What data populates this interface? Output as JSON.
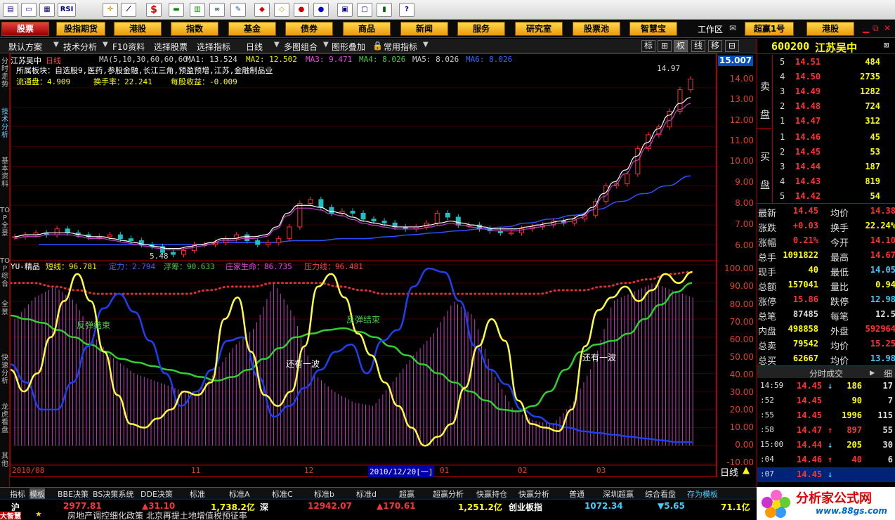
{
  "toolbar": {
    "icons": [
      "chart-icon",
      "monitor-icon",
      "grid-icon",
      "rsi-icon",
      "cross-icon",
      "ruler-icon",
      "dollar-icon",
      "flag-icon",
      "bars-icon",
      "binoculars-icon",
      "pen-icon",
      "bookmark-icon",
      "diamond-icon",
      "tag-icon",
      "tag2-icon",
      "save-icon",
      "window-icon",
      "books-icon",
      "help-icon"
    ],
    "rsi_label": "RSI",
    "dollar_label": "$"
  },
  "nav": {
    "items": [
      "股票",
      "股指期货",
      "港股",
      "指数",
      "基金",
      "债券",
      "商品",
      "新闻",
      "服务",
      "研究室",
      "股票池",
      "智慧宝"
    ],
    "workspace": "工作区",
    "account": "超赢1号",
    "hk": "港股"
  },
  "toolbar2": {
    "items": [
      "默认方案",
      "技术分析",
      "F10资料",
      "选择股票",
      "选择指标",
      "日线",
      "多图组合",
      "图形叠加",
      "常用指标"
    ],
    "right_buttons": [
      "标",
      "⊞",
      "权",
      "线",
      "移",
      "⊟"
    ]
  },
  "vtabs": [
    "分时走势",
    "技术分析",
    "基本资料",
    "TOP全景",
    "TOP综合",
    "全景",
    "快速分析",
    "龙虎看盘",
    "其他"
  ],
  "chart": {
    "header_name": "江苏吴中",
    "header_period": "日线",
    "ma_params": "MA(5,10,30,60,60,60)",
    "ma1": "MA1: 13.524",
    "ma2": "MA2: 12.502",
    "ma3": "MA3: 9.471",
    "ma4": "MA4: 8.026",
    "ma5": "MA5: 8.026",
    "ma6": "MA6: 8.026",
    "sector": "所属板块：自选股9,医药,参股金融,长江三角,预盈预增,江苏,金融制品业",
    "float": "流通盘：4.909",
    "turnover": "换手率：22.241",
    "eps": "每股收益：-0.009",
    "peak_label": "14.97",
    "low_label": "5.48",
    "current_price": "15.007",
    "y_axis": [
      "14.00",
      "13.00",
      "12.00",
      "11.00",
      "10.00",
      "9.00",
      "8.00",
      "7.00",
      "6.00"
    ],
    "ind_name": "YU-精品",
    "short": "短线：96.781",
    "stand": "定力：2.794",
    "float_chip": "浮筹：90.633",
    "life": "庄家生命：86.735",
    "pressure": "压力线：96.481",
    "ind_y": [
      "100.00",
      "90.00",
      "80.00",
      "70.00",
      "60.00",
      "50.00",
      "40.00",
      "30.00",
      "20.00",
      "10.00",
      "0.00",
      "-10.00"
    ],
    "annot": [
      "反弹结束",
      "反弹结束",
      "还有一波",
      "还有一波"
    ],
    "x_labels": [
      "2010/08",
      "11",
      "12",
      "01",
      "02",
      "03"
    ],
    "cursor_date": "2010/12/20[一]",
    "period": "日线"
  },
  "chart_data": [
    {
      "type": "candlestick",
      "title": "江苏吴中 日线",
      "ylim": [
        5.5,
        15.0
      ],
      "close": [
        6.4,
        6.5,
        6.6,
        6.5,
        6.8,
        6.6,
        6.5,
        6.4,
        6.4,
        6.5,
        6.3,
        6.2,
        6.0,
        5.9,
        5.6,
        5.5,
        5.7,
        6.0,
        6.0,
        6.1,
        6.3,
        6.5,
        6.2,
        6.0,
        6.1,
        6.3,
        6.9,
        8.1,
        8.3,
        7.9,
        7.6,
        7.7,
        7.6,
        7.3,
        7.2,
        7.1,
        6.9,
        6.8,
        6.9,
        7.1,
        7.6,
        7.4,
        7.0,
        7.0,
        6.8,
        6.7,
        6.6,
        6.6,
        6.8,
        6.9,
        7.0,
        7.2,
        7.1,
        7.3,
        7.5,
        8.2,
        9.0,
        9.1,
        9.6,
        10.9,
        11.6,
        12.0,
        12.8,
        13.9,
        14.45
      ],
      "ma_fast": [
        6.4,
        6.5,
        6.5,
        6.6,
        6.6,
        6.6,
        6.5,
        6.4,
        6.4,
        6.3,
        6.2,
        6.1,
        6.0,
        5.9,
        5.8,
        5.8,
        5.9,
        6.0,
        6.1,
        6.3,
        6.3,
        6.4,
        6.4,
        6.5,
        6.9,
        7.6,
        8.0,
        8.0,
        7.9,
        7.7,
        7.6,
        7.4,
        7.2,
        7.1,
        7.0,
        6.9,
        6.9,
        6.9,
        7.0,
        7.1,
        7.2,
        7.1,
        7.0,
        6.9,
        6.8,
        6.8,
        6.8,
        6.9,
        7.0,
        7.1,
        7.2,
        7.3,
        7.5,
        7.9,
        8.6,
        9.2,
        9.8,
        10.5,
        11.2,
        11.9,
        12.6,
        13.2,
        13.5
      ],
      "ma_long": [
        6.0,
        6.0,
        6.0,
        6.0,
        6.0,
        6.0,
        6.0,
        6.0,
        6.1,
        6.1,
        6.1,
        6.2,
        6.2,
        6.3,
        6.3,
        6.4,
        6.5,
        6.6,
        6.7,
        6.8,
        6.9,
        7.1,
        7.3,
        7.5,
        7.8,
        8.2,
        8.6,
        9.0,
        9.5
      ]
    },
    {
      "type": "line",
      "title": "YU-精品",
      "ylim": [
        -10,
        100
      ],
      "series": [
        {
          "name": "短线",
          "values": [
            42,
            30,
            40,
            60,
            80,
            95,
            80,
            52,
            28,
            12,
            10,
            15,
            20,
            30,
            28,
            35,
            70,
            82,
            52,
            28,
            22,
            30,
            55,
            88,
            95,
            82,
            62,
            50,
            35,
            22,
            10,
            0,
            5,
            12,
            32,
            55,
            70,
            58,
            25,
            12,
            10,
            8,
            20,
            55,
            75,
            82,
            88,
            80,
            86,
            95,
            90,
            96
          ]
        },
        {
          "name": "定力",
          "values": [
            45,
            35,
            20,
            20,
            35,
            55,
            76,
            84,
            74,
            58,
            40,
            22,
            30,
            42,
            58,
            60,
            38,
            16,
            22,
            32,
            42,
            52,
            56,
            40,
            58,
            64,
            88,
            98,
            96,
            80,
            55,
            42,
            34,
            20,
            16,
            12,
            10,
            8,
            7,
            6,
            5,
            4,
            3,
            2,
            2
          ]
        },
        {
          "name": "浮筹",
          "values": [
            72,
            70,
            68,
            64,
            60,
            56,
            52,
            48,
            46,
            44,
            42,
            40,
            38,
            36,
            38,
            42,
            48,
            54,
            60,
            62,
            64,
            65,
            63,
            60,
            55,
            50,
            45,
            40,
            35,
            30,
            25,
            20,
            19,
            22,
            30,
            42,
            52,
            56,
            58,
            62,
            70,
            78,
            85,
            90
          ]
        },
        {
          "name": "压力线",
          "values": [
            90,
            90,
            88,
            86,
            84,
            84,
            84,
            84,
            84,
            86,
            88,
            88,
            90,
            90,
            90,
            88,
            86,
            84,
            84,
            84,
            84,
            84,
            84,
            84,
            84,
            86,
            86,
            88,
            90,
            92,
            95,
            96
          ]
        },
        {
          "name": "庄家生命",
          "values": [
            70,
            82,
            88,
            80,
            60,
            48,
            40,
            36,
            32,
            28,
            40,
            55,
            65,
            90,
            72,
            40,
            30,
            24,
            22,
            36,
            50,
            62,
            80,
            72,
            40,
            20,
            14,
            12,
            24,
            45,
            80,
            85,
            90,
            86,
            82
          ]
        }
      ]
    }
  ],
  "quote": {
    "code": "600200",
    "name": "江苏吴中",
    "asks": [
      {
        "level": "5",
        "price": "14.51",
        "vol": "484"
      },
      {
        "level": "4",
        "price": "14.50",
        "vol": "2735"
      },
      {
        "level": "3",
        "price": "14.49",
        "vol": "1282"
      },
      {
        "level": "2",
        "price": "14.48",
        "vol": "724"
      },
      {
        "level": "1",
        "price": "14.47",
        "vol": "312"
      }
    ],
    "bids": [
      {
        "level": "1",
        "price": "14.46",
        "vol": "45"
      },
      {
        "level": "2",
        "price": "14.45",
        "vol": "53"
      },
      {
        "level": "3",
        "price": "14.44",
        "vol": "187"
      },
      {
        "level": "4",
        "price": "14.43",
        "vol": "819"
      },
      {
        "level": "5",
        "price": "14.42",
        "vol": "54"
      }
    ],
    "sell_label": "卖盘",
    "buy_label": "买盘",
    "stats": [
      [
        "最新",
        "14.45",
        "均价",
        "14.38"
      ],
      [
        "涨跌",
        "+0.03",
        "换手",
        "22.24%"
      ],
      [
        "涨幅",
        "0.21%",
        "今开",
        "14.10"
      ],
      [
        "总手",
        "1091822",
        "最高",
        "14.67"
      ],
      [
        "现手",
        "40",
        "最低",
        "14.05"
      ],
      [
        "总额",
        "157041",
        "量比",
        "0.94"
      ],
      [
        "涨停",
        "15.86",
        "跌停",
        "12.98"
      ],
      [
        "总笔",
        "87485",
        "每笔",
        "12.5"
      ],
      [
        "内盘",
        "498858",
        "外盘",
        "592964"
      ],
      [
        "总卖",
        "79542",
        "均价",
        "15.25"
      ],
      [
        "总买",
        "62667",
        "均价",
        "13.98"
      ]
    ],
    "ticks_title": "分时成交",
    "ticks_more": "细",
    "ticks": [
      [
        "14:59",
        "14.45",
        "↓",
        "186",
        "17"
      ],
      [
        ":52",
        "14.45",
        "",
        "90",
        "7"
      ],
      [
        ":55",
        "14.45",
        "",
        "1996",
        "115"
      ],
      [
        ":58",
        "14.47",
        "↑",
        "897",
        "55"
      ],
      [
        "15:00",
        "14.44",
        "↓",
        "205",
        "30"
      ],
      [
        ":04",
        "14.46",
        "↑",
        "40",
        "6"
      ],
      [
        ":07",
        "14.45",
        "↓",
        "",
        ""
      ]
    ]
  },
  "bottom_tabs": [
    "指标",
    "模板",
    "BBE决策",
    "BS决策系统",
    "DDE决策",
    "标准",
    "标准A",
    "标准C",
    "标准b",
    "标准d",
    "超赢",
    "超赢分析",
    "快赢持仓",
    "快赢分析",
    "普通",
    "深圳超赢",
    "综合看盘",
    "存为模板"
  ],
  "index_bar": {
    "sh": "沪",
    "sh_val": "2977.81",
    "sh_chg": "▲31.10",
    "sh_amt": "1,738.2亿",
    "sz": "深",
    "sz_val": "12942.07",
    "sz_chg": "▲170.61",
    "sz_amt": "1,251.2亿",
    "cy": "创业板指",
    "cy_val": "1072.34",
    "cy_chg": "▼5.65",
    "cy_amt": "71.1亿"
  },
  "news": {
    "brand": "大智慧",
    "text": "房地产调控细化政策 北京再提土地增值税预征率"
  },
  "logo": {
    "name": "分析家公式网",
    "url": "www.88gs.com"
  }
}
